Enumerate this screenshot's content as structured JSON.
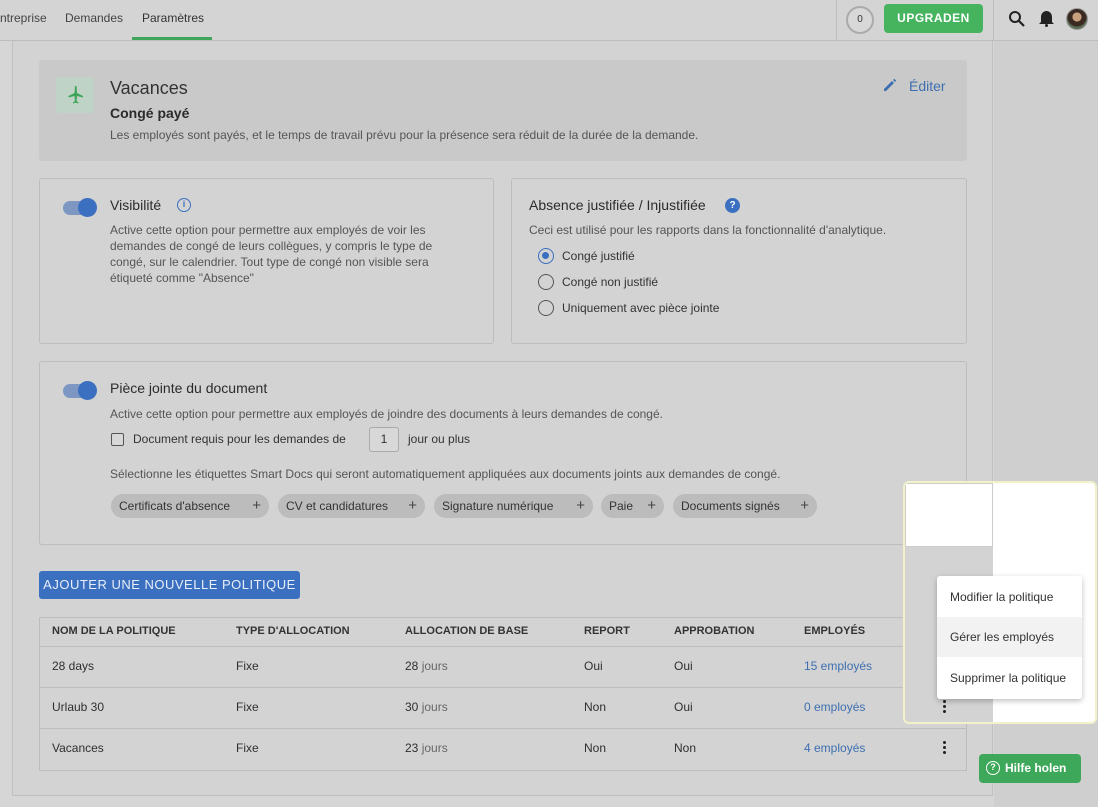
{
  "nav": {
    "tabs": [
      "ntreprise",
      "Demandes",
      "Paramètres"
    ],
    "counter": "0",
    "upgrade_label": "UPGRADEN",
    "icons": [
      "search-icon",
      "notification-bell-icon",
      "avatar"
    ]
  },
  "policy_header": {
    "icon": "airplane-icon",
    "title": "Vacances",
    "subtitle": "Congé payé",
    "description": "Les employés sont payés, et le temps de travail prévu pour la présence sera réduit de la durée de la demande.",
    "edit_label": "Éditer"
  },
  "visibility": {
    "title": "Visibilité",
    "enabled": true,
    "description": "Active cette option pour permettre aux employés de voir les demandes de congé de leurs collègues, y compris le type de congé, sur le calendrier. Tout type de congé non visible sera étiqueté comme \"Absence\""
  },
  "justification": {
    "title": "Absence justifiée / Injustifiée",
    "description": "Ceci est utilisé pour les rapports dans la fonctionnalité d'analytique.",
    "options": [
      "Congé justifié",
      "Congé non justifié",
      "Uniquement avec pièce jointe"
    ],
    "selected": "Congé justifié"
  },
  "attachment": {
    "title": "Pièce jointe du document",
    "enabled": true,
    "description": "Active cette option pour permettre aux employés de joindre des documents à leurs demandes de congé.",
    "require_label": "Document requis pour les demandes de",
    "require_checked": false,
    "days_value": "1",
    "days_suffix": "jour ou plus",
    "tags_description": "Sélectionne les étiquettes Smart Docs qui seront automatiquement appliquées aux documents joints aux demandes de congé.",
    "tags": [
      "Certificats d'absence",
      "CV et candidatures",
      "Signature numérique",
      "Paie",
      "Documents signés"
    ]
  },
  "add_policy_label": "AJOUTER UNE NOUVELLE POLITIQUE",
  "table": {
    "headers": [
      "NOM DE LA POLITIQUE",
      "TYPE D'ALLOCATION",
      "ALLOCATION DE BASE",
      "REPORT",
      "APPROBATION",
      "EMPLOYÉS"
    ],
    "rows": [
      {
        "name": "28 days",
        "type": "Fixe",
        "base_num": "28",
        "base_unit": "jours",
        "report": "Oui",
        "approval": "Oui",
        "employees": "15 employés"
      },
      {
        "name": "Urlaub 30",
        "type": "Fixe",
        "base_num": "30",
        "base_unit": "jours",
        "report": "Non",
        "approval": "Oui",
        "employees": "0 employés"
      },
      {
        "name": "Vacances",
        "type": "Fixe",
        "base_num": "23",
        "base_unit": "jours",
        "report": "Non",
        "approval": "Non",
        "employees": "4 employés"
      }
    ]
  },
  "context_menu": {
    "items": [
      "Modifier la politique",
      "Gérer les employés",
      "Supprimer la politique"
    ],
    "hovered": "Gérer les employés"
  },
  "help_label": "Hilfe holen"
}
